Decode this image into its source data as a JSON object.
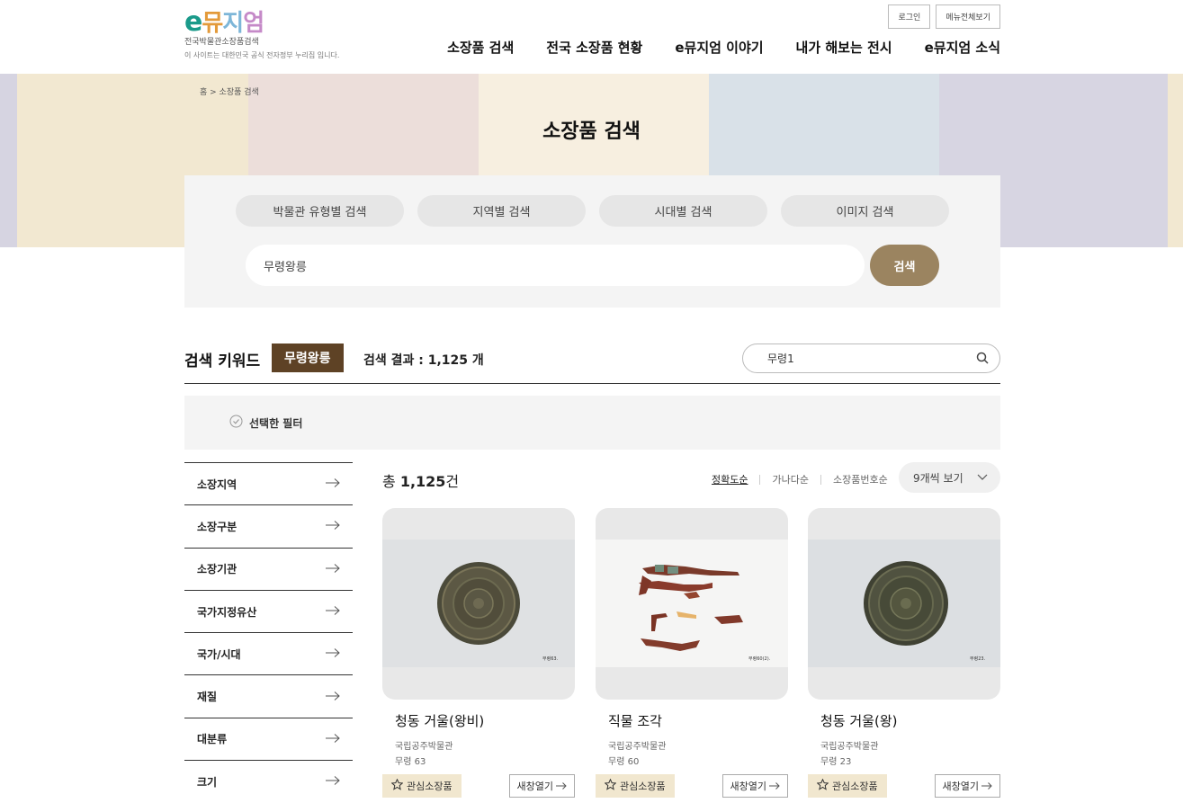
{
  "header": {
    "logo": {
      "e": "e",
      "m1": "뮤",
      "m2": "지",
      "m3": "엄",
      "sub": "전국박물관소장품검색",
      "note": "이 사이트는 대한민국 공식 전자정부 누리집 입니다."
    },
    "top_buttons": {
      "login": "로그인",
      "all_menu": "메뉴전체보기"
    },
    "nav": [
      "소장품 검색",
      "전국 소장품 현황",
      "e뮤지엄 이야기",
      "내가 해보는 전시",
      "e뮤지엄 소식"
    ]
  },
  "banner": {
    "colors": [
      "#d6d4e1",
      "#f2e8d1",
      "#ecdeda",
      "#f7efe0",
      "#d9e1e8",
      "#d7d5e2",
      "#f2e8d1"
    ],
    "breadcrumb": "홈 > 소장품 검색",
    "title": "소장품 검색"
  },
  "search": {
    "tabs": [
      "박물관 유형별 검색",
      "지역별 검색",
      "시대별 검색",
      "이미지 검색"
    ],
    "query": "무령왕릉",
    "button": "검색"
  },
  "keyword_bar": {
    "label": "검색 키워드",
    "chip": "무령왕릉",
    "result": "검색 결과 : 1,125 개",
    "refine_value": "무령1"
  },
  "filter": {
    "label": "선택한 필터"
  },
  "sidebar": [
    "소장지역",
    "소장구분",
    "소장기관",
    "국가지정유산",
    "국가/시대",
    "재질",
    "대분류",
    "크기"
  ],
  "results": {
    "total_prefix": "총 ",
    "total_count": "1,125",
    "total_suffix": "건",
    "sorts": [
      "정확도순",
      "가나다순",
      "소장품번호순"
    ],
    "active_sort": "정확도순",
    "per_page": "9개씩 보기"
  },
  "cards": [
    {
      "title": "청동 거울(왕비)",
      "org": "국립공주박물관",
      "no": "무령 63",
      "tag": "무령63.",
      "fav": "관심소장품",
      "open": "새창열기"
    },
    {
      "title": "직물 조각",
      "org": "국립공주박물관",
      "no": "무령 60",
      "tag": "무령60(2).",
      "fav": "관심소장품",
      "open": "새창열기"
    },
    {
      "title": "청동 거울(왕)",
      "org": "국립공주박물관",
      "no": "무령 23",
      "tag": "무령23.",
      "fav": "관심소장품",
      "open": "새창열기"
    }
  ],
  "colors": {
    "accent_brown": "#9b8460",
    "chip_brown": "#5e4225",
    "fav_bg": "#f1e7cf"
  }
}
